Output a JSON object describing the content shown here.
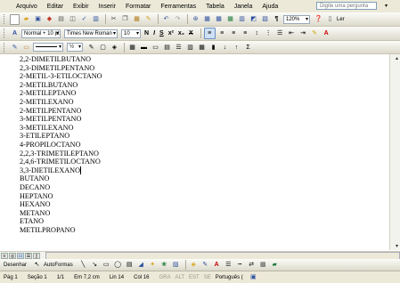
{
  "menu": {
    "items": [
      "Arquivo",
      "Editar",
      "Exibir",
      "Inserir",
      "Formatar",
      "Ferramentas",
      "Tabela",
      "Janela",
      "Ajuda"
    ],
    "help_placeholder": "Digite uma pergunta"
  },
  "formatting": {
    "style": "Normal + 10 pt",
    "font": "Times New Roman",
    "size": "10",
    "zoom": "120%",
    "read_label": "Ler"
  },
  "document": {
    "lines": [
      "2,2-DIMETILBUTANO",
      "2,3-DIMETILPENTANO",
      "2-METIL-3-ETILOCTANO",
      "2-METILBUTANO",
      "2-METILEPTANO",
      "2-METILEXANO",
      "2-METILPENTANO",
      "3-METILPENTANO",
      "3-METILEXANO",
      "3-ETILEPTANO",
      "4-PROPILOCTANO",
      "2,2,3-TRIMETILEPTANO",
      "2,4,6-TRIMETILOCTANO",
      "3,3-DIETILEXANO",
      "BUTANO",
      "DECANO",
      "HEPTANO",
      "HEXANO",
      "METANO",
      "ETANO",
      "METILPROPANO"
    ]
  },
  "drawing": {
    "draw_label": "Desenhar",
    "autoshapes_label": "AutoFormas"
  },
  "status": {
    "page": "Pág 1",
    "section": "Seção 1",
    "pages": "1/1",
    "position": "Em 7,2 cm",
    "line": "Lin 14",
    "column": "Col 16",
    "rec": "GRA",
    "trk": "ALT",
    "ext": "EST",
    "ovr": "SE",
    "language": "Português ("
  }
}
